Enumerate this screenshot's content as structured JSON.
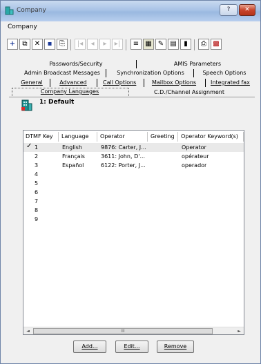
{
  "window": {
    "title": "Company",
    "help_label": "?",
    "close_label": "✕"
  },
  "menu": {
    "company": "Company"
  },
  "tabs": {
    "row1": [
      "Passwords/Security",
      "AMIS Parameters"
    ],
    "row2": [
      "Admin Broadcast Messages",
      "Synchronization Options",
      "Speech Options"
    ],
    "row3": [
      "General",
      "Advanced",
      "Call Options",
      "Mailbox Options",
      "Integrated fax"
    ],
    "row4": [
      "Company Languages",
      "C.D./Channel Assignment"
    ]
  },
  "company": {
    "name": "1: Default"
  },
  "list": {
    "headers": [
      "DTMF Key",
      "Language",
      "Operator",
      "Greeting",
      "Operator Keyword(s)"
    ],
    "rows": [
      {
        "key": "1",
        "language": "English",
        "operator": "9876: Carter, J...",
        "greeting": "",
        "keyword": "Operator",
        "selected": true
      },
      {
        "key": "2",
        "language": "Français",
        "operator": "3611: John, D'...",
        "greeting": "",
        "keyword": "opérateur"
      },
      {
        "key": "3",
        "language": "Español",
        "operator": "6122: Porter, J...",
        "greeting": "",
        "keyword": "operador"
      },
      {
        "key": "4"
      },
      {
        "key": "5"
      },
      {
        "key": "6"
      },
      {
        "key": "7"
      },
      {
        "key": "8"
      },
      {
        "key": "9"
      }
    ]
  },
  "scroll": {
    "left": "◄",
    "right": "►",
    "thumb": "III"
  },
  "buttons": {
    "add": "Add...",
    "edit": "Edit...",
    "remove": "Remove"
  },
  "colors": {
    "titlebar": "#a9c3e6",
    "close": "#c8452c",
    "selected_row": "#e9e9e9"
  }
}
